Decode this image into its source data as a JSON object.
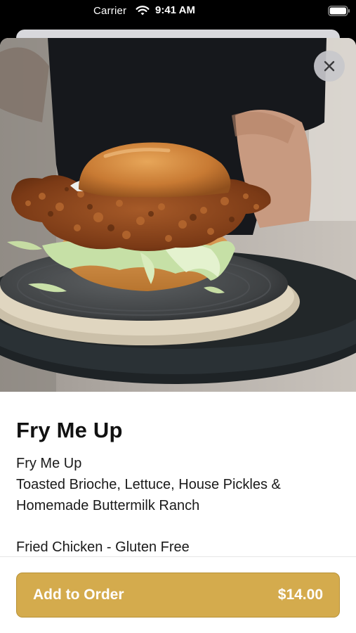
{
  "status_bar": {
    "carrier": "Carrier",
    "time": "9:41 AM"
  },
  "item": {
    "title": "Fry Me Up",
    "description_lines": [
      "Fry Me Up",
      "Toasted Brioche, Lettuce, House Pickles &",
      "Homemade Buttermilk Ranch"
    ],
    "dietary": "Fried Chicken - Gluten Free"
  },
  "order_button": {
    "label": "Add to Order",
    "price": "$14.00"
  },
  "colors": {
    "accent": "#d4ab4d",
    "text": "#111111",
    "background": "#ffffff"
  },
  "icons": {
    "close": "close-icon",
    "wifi": "wifi-icon",
    "battery": "battery-icon"
  }
}
